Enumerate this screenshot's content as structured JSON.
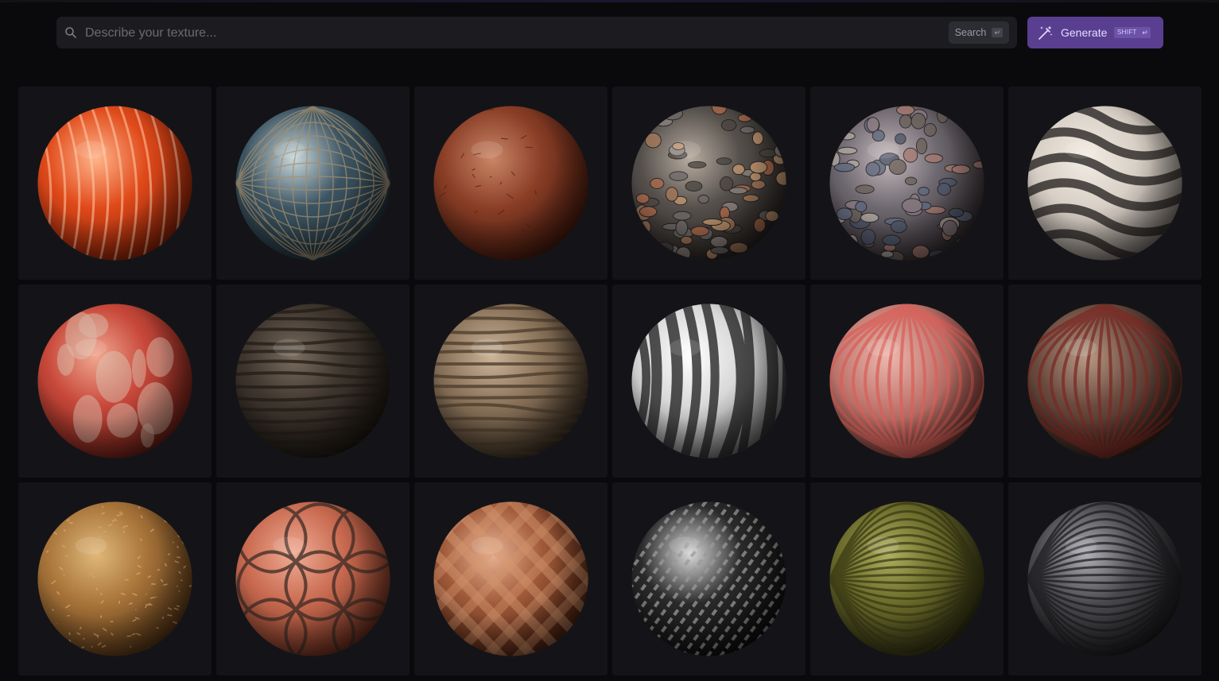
{
  "search": {
    "placeholder": "Describe your texture...",
    "value": "",
    "button_label": "Search",
    "button_key": "↵"
  },
  "generate": {
    "label": "Generate",
    "shift_key": "SHIFT",
    "enter_key": "↵",
    "accent": "#5a3f91"
  },
  "materials": [
    {
      "name": "orange-stripe-sphere",
      "base": "#e04a1a",
      "hi": "#ffb48a",
      "lo": "#7a1c06",
      "pattern": "stripes",
      "pc": "#ffd1b0"
    },
    {
      "name": "glass-tile-sphere",
      "base": "#3c5462",
      "hi": "#c9d8dc",
      "lo": "#1a2830",
      "pattern": "grid",
      "pc": "#a38f6e"
    },
    {
      "name": "brown-leather-sphere",
      "base": "#8a3e26",
      "hi": "#c98666",
      "lo": "#3a140a",
      "pattern": "none",
      "pc": "#5a2212"
    },
    {
      "name": "pebble-mix-sphere",
      "base": "#55504c",
      "hi": "#b8aca0",
      "lo": "#1e1a18",
      "pattern": "pebbles",
      "pc": "#c48a5a"
    },
    {
      "name": "river-stones-sphere",
      "base": "#6e6870",
      "hi": "#c8bcbf",
      "lo": "#2a2426",
      "pattern": "stones",
      "pc": "#9b5a5e"
    },
    {
      "name": "black-white-mosaic-sphere",
      "base": "#d8d0c6",
      "hi": "#f2ece4",
      "lo": "#6a6460",
      "pattern": "waves",
      "pc": "#1e1a18"
    },
    {
      "name": "peeling-red-paint-sphere",
      "base": "#c8483a",
      "hi": "#f0a890",
      "lo": "#5a1812",
      "pattern": "patches",
      "pc": "#d8c8b8"
    },
    {
      "name": "dark-rock-sphere",
      "base": "#3e352e",
      "hi": "#7a6c5e",
      "lo": "#16120e",
      "pattern": "layers",
      "pc": "#221c16"
    },
    {
      "name": "cliff-rock-sphere",
      "base": "#8a735a",
      "hi": "#cbb498",
      "lo": "#2e241a",
      "pattern": "layers",
      "pc": "#4a3a2a"
    },
    {
      "name": "white-black-zebra-sphere",
      "base": "#d8d8d8",
      "hi": "#ffffff",
      "lo": "#5a5a5a",
      "pattern": "zebra",
      "pc": "#1a1a1a"
    },
    {
      "name": "red-fabric-sphere",
      "base": "#c27a72",
      "hi": "#ecb8ae",
      "lo": "#6a302a",
      "pattern": "vstripes",
      "pc": "#d8605a"
    },
    {
      "name": "red-tree-bark-sphere",
      "base": "#6a4a3e",
      "hi": "#b89a86",
      "lo": "#261a14",
      "pattern": "vstripes",
      "pc": "#7a2a24"
    },
    {
      "name": "straw-sphere",
      "base": "#a8743a",
      "hi": "#e0b87a",
      "lo": "#4a2e12",
      "pattern": "speckle",
      "pc": "#d9a868"
    },
    {
      "name": "terracotta-tile-sphere",
      "base": "#c86a50",
      "hi": "#f0ac94",
      "lo": "#5a2618",
      "pattern": "arabesque",
      "pc": "#3a2a24"
    },
    {
      "name": "woven-wood-sphere",
      "base": "#a05a3a",
      "hi": "#e8b292",
      "lo": "#3e1a0c",
      "pattern": "weave",
      "pc": "#d89a72"
    },
    {
      "name": "carbon-fiber-sphere",
      "base": "#2a2a2a",
      "hi": "#d8d8d8",
      "lo": "#0a0a0a",
      "pattern": "diag",
      "pc": "#9a9a9a"
    },
    {
      "name": "green-ribbed-sphere",
      "base": "#6a6a2a",
      "hi": "#b0b060",
      "lo": "#242410",
      "pattern": "hstripes",
      "pc": "#3a3a14"
    },
    {
      "name": "dark-scaly-sphere",
      "base": "#4a4a4e",
      "hi": "#b0b0b6",
      "lo": "#141416",
      "pattern": "hstripes",
      "pc": "#1e1e22"
    }
  ]
}
